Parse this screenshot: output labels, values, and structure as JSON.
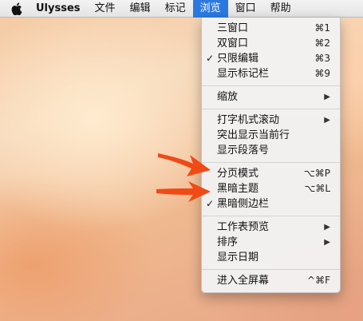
{
  "menubar": {
    "app_name": "Ulysses",
    "items": [
      "文件",
      "编辑",
      "标记",
      "浏览",
      "窗口",
      "帮助"
    ],
    "active_index": 3
  },
  "menu": {
    "g1": [
      {
        "label": "三窗口",
        "shortcut": "⌘1"
      },
      {
        "label": "双窗口",
        "shortcut": "⌘2"
      },
      {
        "label": "只限编辑",
        "shortcut": "⌘3",
        "checked": true
      },
      {
        "label": "显示标记栏",
        "shortcut": "⌘9"
      }
    ],
    "g2": [
      {
        "label": "缩放",
        "submenu": true
      }
    ],
    "g3": [
      {
        "label": "打字机式滚动",
        "submenu": true
      },
      {
        "label": "突出显示当前行"
      },
      {
        "label": "显示段落号"
      }
    ],
    "g4": [
      {
        "label": "分页模式",
        "shortcut": "⌥⌘P"
      },
      {
        "label": "黑暗主题",
        "shortcut": "⌥⌘L"
      },
      {
        "label": "黑暗侧边栏",
        "checked": true
      }
    ],
    "g5": [
      {
        "label": "工作表预览",
        "submenu": true
      },
      {
        "label": "排序",
        "submenu": true
      },
      {
        "label": "显示日期"
      }
    ],
    "g6": [
      {
        "label": "进入全屏幕",
        "shortcut": "^⌘F"
      }
    ]
  },
  "annotation_color": "#f04a16",
  "icons": {
    "check": "checkmark-icon",
    "submenu": "triangle-right-icon",
    "apple": "apple-logo-icon"
  }
}
